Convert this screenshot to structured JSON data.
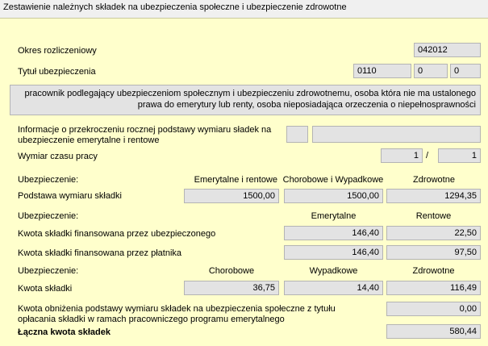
{
  "window": {
    "title": "Zestawienie należnych składek na ubezpieczenia społeczne i ubezpieczenie zdrowotne"
  },
  "okres": {
    "label": "Okres rozliczeniowy",
    "value": "042012"
  },
  "tytul": {
    "label": "Tytuł ubezpieczenia",
    "code": "0110",
    "v2": "0",
    "v3": "0",
    "description": "pracownik podlegający ubezpieczeniom społecznym i ubezpieczeniu zdrowotnemu, osoba która nie ma ustalonego prawa do emerytury lub renty, osoba nieposiadająca orzeczenia o niepełnosprawności"
  },
  "przekroczenie": {
    "label_line1": "Informacje o przekroczeniu rocznej podstawy wymiaru sładek na",
    "label_line2": "ubezpieczenie emerytalne i rentowe",
    "flag": "",
    "date": ""
  },
  "wymiar": {
    "label": "Wymiar czasu pracy",
    "num": "1",
    "sep": "/",
    "den": "1"
  },
  "section1": {
    "label": "Ubezpieczenie:",
    "col1": "Emerytalne i rentowe",
    "col2": "Chorobowe i Wypadkowe",
    "col3": "Zdrowotne",
    "row_label": "Podstawa wymiaru składki",
    "v1": "1500,00",
    "v2": "1500,00",
    "v3": "1294,35"
  },
  "section2": {
    "label": "Ubezpieczenie:",
    "col1": "Emerytalne",
    "col2": "Rentowe",
    "row1_label": "Kwota składki finansowana przez ubezpieczonego",
    "row1_v1": "146,40",
    "row1_v2": "22,50",
    "row2_label": "Kwota składki finansowana przez płatnika",
    "row2_v1": "146,40",
    "row2_v2": "97,50"
  },
  "section3": {
    "label": "Ubezpieczenie:",
    "col1": "Chorobowe",
    "col2": "Wypadkowe",
    "col3": "Zdrowotne",
    "row_label": "Kwota składki",
    "v1": "36,75",
    "v2": "14,40",
    "v3": "116,49"
  },
  "obnizenie": {
    "label_line1": "Kwota obniżenia podstawy wymiaru składek na ubezpieczenia społeczne z tytułu",
    "label_line2": "opłacania składki w ramach pracowniczego programu emerytalnego",
    "value": "0,00"
  },
  "laczna": {
    "label": "Łączna kwota składek",
    "value": "580,44"
  }
}
